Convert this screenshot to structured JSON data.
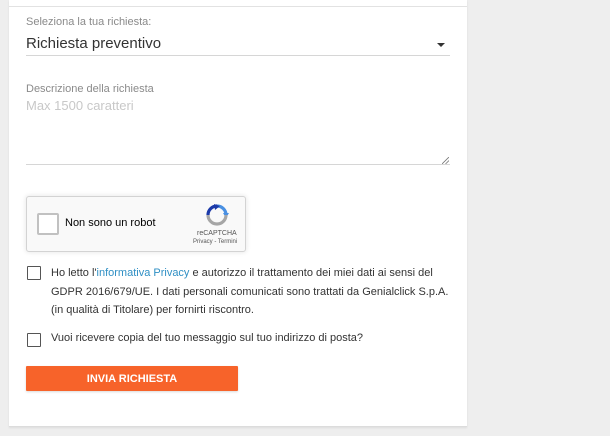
{
  "form": {
    "request_type_label": "Seleziona la tua richiesta:",
    "request_type_value": "Richiesta preventivo",
    "description_label": "Descrizione della richiesta",
    "description_placeholder": "Max 1500 caratteri",
    "description_value": ""
  },
  "recaptcha": {
    "label": "Non sono un robot",
    "brand": "reCAPTCHA",
    "terms": "Privacy - Termini"
  },
  "privacy": {
    "checked": false,
    "text_before": "Ho letto l'",
    "link_text": "informativa Privacy",
    "text_after": " e autorizzo il trattamento dei miei dati ai sensi del GDPR 2016/679/UE. I dati personali comunicati sono trattati da Genialclick S.p.A. (in qualità di Titolare) per fornirti riscontro."
  },
  "copy_option": {
    "checked": false,
    "text": "Vuoi ricevere copia del tuo messaggio sul tuo indirizzo di posta?"
  },
  "submit_label": "INVIA RICHIESTA",
  "colors": {
    "accent": "#f7632a",
    "link": "#2f8fc4",
    "page_background": "#eeeeee"
  },
  "icons": [
    "chevron-down-icon",
    "recaptcha-logo-icon",
    "resize-grip-icon"
  ]
}
